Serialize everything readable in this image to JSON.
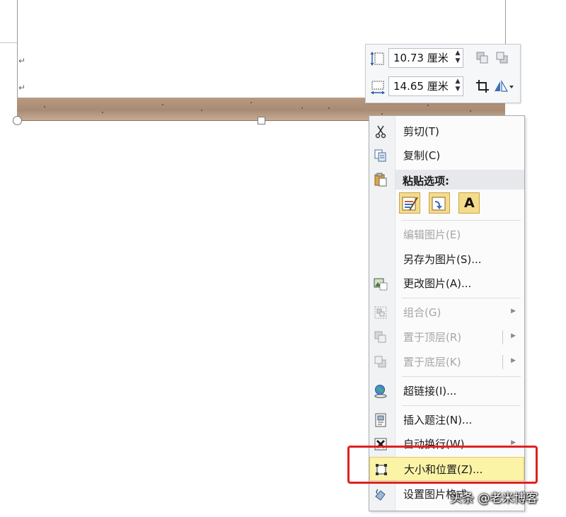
{
  "document": {
    "paragraph_mark": "↵"
  },
  "mini_toolbar": {
    "height_value": "10.73 厘米",
    "width_value": "14.65 厘米",
    "spin_up": "▲",
    "spin_down": "▼"
  },
  "context_menu": {
    "items": [
      {
        "label": "剪切(T)",
        "icon": "scissors-icon",
        "enabled": true
      },
      {
        "label": "复制(C)",
        "icon": "copy-icon",
        "enabled": true
      },
      {
        "label": "粘贴选项:",
        "icon": "paste-icon",
        "enabled": true
      },
      {
        "label": "编辑图片(E)",
        "icon": "",
        "enabled": false
      },
      {
        "label": "另存为图片(S)...",
        "icon": "",
        "enabled": true
      },
      {
        "label": "更改图片(A)...",
        "icon": "change-picture-icon",
        "enabled": true
      },
      {
        "label": "组合(G)",
        "icon": "group-icon",
        "enabled": false,
        "submenu": true
      },
      {
        "label": "置于顶层(R)",
        "icon": "bring-to-front-icon",
        "enabled": false,
        "submenu": true
      },
      {
        "label": "置于底层(K)",
        "icon": "send-to-back-icon",
        "enabled": false,
        "submenu": true
      },
      {
        "label": "超链接(I)...",
        "icon": "hyperlink-globe-icon",
        "enabled": true
      },
      {
        "label": "插入题注(N)...",
        "icon": "caption-icon",
        "enabled": true
      },
      {
        "label": "自动换行(W)",
        "icon": "text-wrap-icon",
        "enabled": true,
        "submenu": true
      },
      {
        "label": "大小和位置(Z)...",
        "icon": "size-position-icon",
        "enabled": true,
        "highlighted": true
      },
      {
        "label": "设置图片格式",
        "icon": "format-picture-icon",
        "enabled": true
      }
    ],
    "submenu_arrow": "▶",
    "paste_letter": "A"
  },
  "watermark": "头条 @老米博客",
  "colors": {
    "highlight_box": "#e02020",
    "hover_fill": "#fbf3a6",
    "photo": "#b89a83"
  }
}
